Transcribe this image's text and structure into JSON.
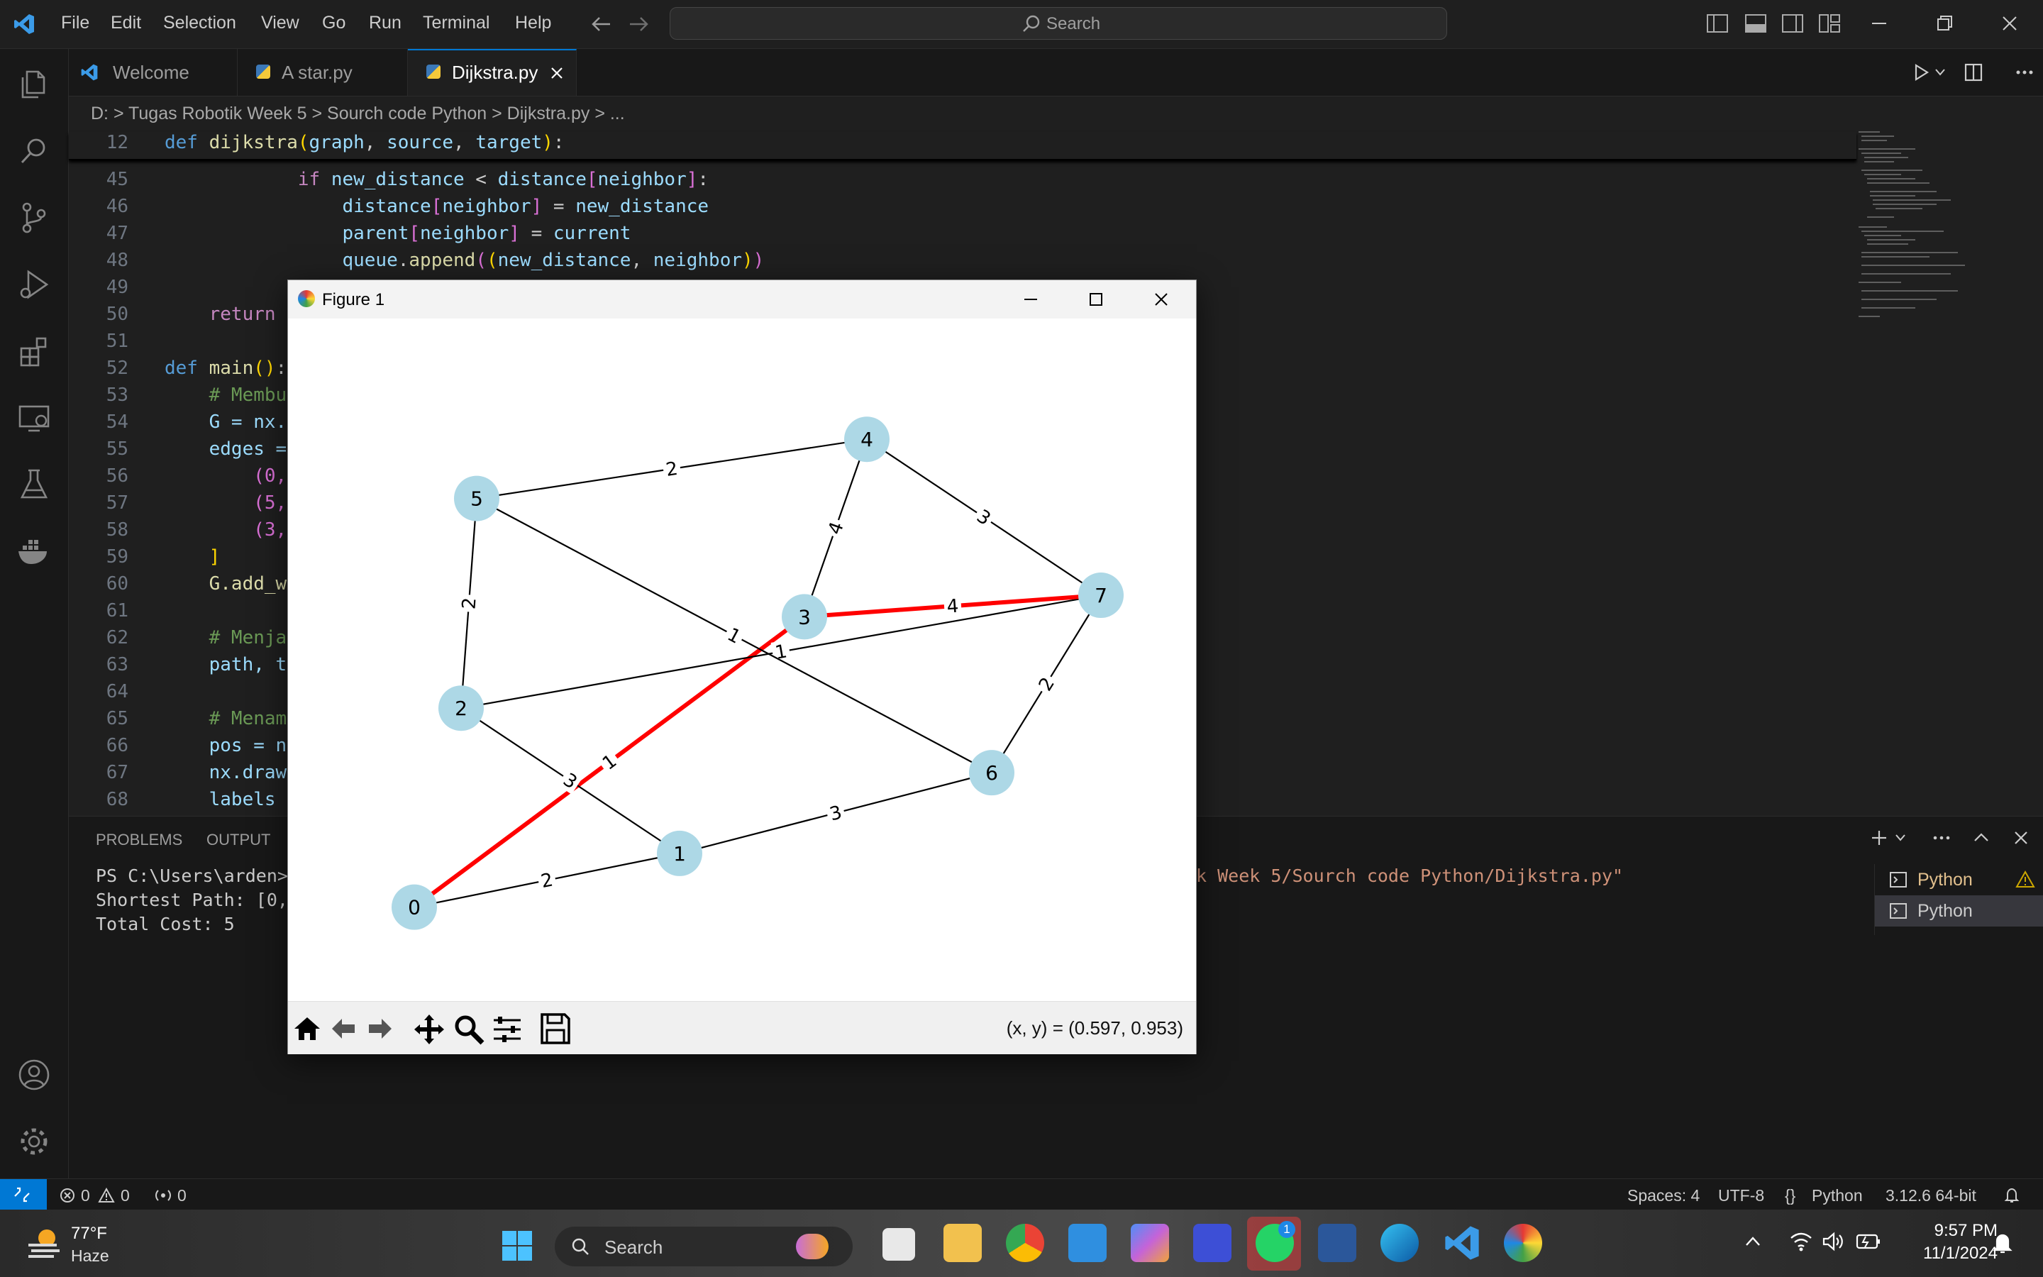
{
  "menu": [
    "File",
    "Edit",
    "Selection",
    "View",
    "Go",
    "Run",
    "Terminal",
    "Help"
  ],
  "search": {
    "placeholder": "Search"
  },
  "tabs": [
    {
      "label": "Welcome",
      "icon": "vscode-icon"
    },
    {
      "label": "A star.py",
      "icon": "python-icon"
    },
    {
      "label": "Dijkstra.py",
      "icon": "python-icon",
      "active": true
    }
  ],
  "breadcrumb": "D: > Tugas Robotik Week 5 > Sourch code Python > Dijkstra.py > ...",
  "sticky": {
    "ln": "12",
    "code": "def dijkstra(graph, source, target):"
  },
  "lines": [
    {
      "ln": "45",
      "code": "            if new_distance < distance[neighbor]:"
    },
    {
      "ln": "46",
      "code": "                distance[neighbor] = new_distance"
    },
    {
      "ln": "47",
      "code": "                parent[neighbor] = current"
    },
    {
      "ln": "48",
      "code": "                queue.append((new_distance, neighbor))"
    },
    {
      "ln": "49",
      "code": ""
    },
    {
      "ln": "50",
      "code": "    return"
    },
    {
      "ln": "51",
      "code": ""
    },
    {
      "ln": "52",
      "code": "def main():"
    },
    {
      "ln": "53",
      "code": "    # Membu"
    },
    {
      "ln": "54",
      "code": "    G = nx."
    },
    {
      "ln": "55",
      "code": "    edges ="
    },
    {
      "ln": "56",
      "code": "        (0,"
    },
    {
      "ln": "57",
      "code": "        (5,"
    },
    {
      "ln": "58",
      "code": "        (3,"
    },
    {
      "ln": "59",
      "code": "    ]"
    },
    {
      "ln": "60",
      "code": "    G.add_w"
    },
    {
      "ln": "61",
      "code": ""
    },
    {
      "ln": "62",
      "code": "    # Menja"
    },
    {
      "ln": "63",
      "code": "    path, t"
    },
    {
      "ln": "64",
      "code": ""
    },
    {
      "ln": "65",
      "code": "    # Menam"
    },
    {
      "ln": "66",
      "code": "    pos = n"
    },
    {
      "ln": "67",
      "code": "    nx.draw"
    },
    {
      "ln": "68",
      "code": "    labels"
    }
  ],
  "panel": {
    "tabs": [
      "PROBLEMS",
      "OUTPUT"
    ],
    "terminal": [
      "PS C:\\Users\\arden>",
      "Shortest Path: [0,",
      "Total Cost: 5"
    ],
    "terminal_tail": "k Week 5/Sourch code Python/Dijkstra.py\"",
    "terminals": [
      "Python",
      "Python"
    ]
  },
  "status": {
    "errors": "0",
    "warnings": "0",
    "ports": "0",
    "spaces": "Spaces: 4",
    "encoding": "UTF-8",
    "language": "Python",
    "interpreter": "3.12.6 64-bit"
  },
  "taskbar": {
    "weather_temp": "77°F",
    "weather_desc": "Haze",
    "search": "Search",
    "time": "9:57 PM",
    "date": "11/1/2024",
    "whatsapp_badge": "1"
  },
  "figure": {
    "title": "Figure 1",
    "coords": "(x, y) = (0.597, 0.953)"
  },
  "chart_data": {
    "type": "graph",
    "nodes": [
      {
        "id": "0",
        "x": 0.08,
        "y": 0.04
      },
      {
        "id": "1",
        "x": 0.42,
        "y": 0.14
      },
      {
        "id": "2",
        "x": 0.14,
        "y": 0.41
      },
      {
        "id": "3",
        "x": 0.58,
        "y": 0.58
      },
      {
        "id": "4",
        "x": 0.66,
        "y": 0.91
      },
      {
        "id": "5",
        "x": 0.16,
        "y": 0.8
      },
      {
        "id": "6",
        "x": 0.82,
        "y": 0.29
      },
      {
        "id": "7",
        "x": 0.96,
        "y": 0.62
      }
    ],
    "edges": [
      {
        "source": "0",
        "target": "1",
        "weight": "2",
        "path": false
      },
      {
        "source": "0",
        "target": "3",
        "weight": "1",
        "path": true
      },
      {
        "source": "1",
        "target": "2",
        "weight": "3",
        "path": false
      },
      {
        "source": "1",
        "target": "6",
        "weight": "3",
        "path": false
      },
      {
        "source": "2",
        "target": "5",
        "weight": "2",
        "path": false
      },
      {
        "source": "2",
        "target": "7",
        "weight": "1",
        "path": false
      },
      {
        "source": "5",
        "target": "4",
        "weight": "2",
        "path": false
      },
      {
        "source": "5",
        "target": "6",
        "weight": "1",
        "path": false
      },
      {
        "source": "3",
        "target": "4",
        "weight": "4",
        "path": false
      },
      {
        "source": "3",
        "target": "7",
        "weight": "4",
        "path": true
      },
      {
        "source": "4",
        "target": "7",
        "weight": "3",
        "path": false
      },
      {
        "source": "6",
        "target": "7",
        "weight": "2",
        "path": false
      }
    ],
    "colors": {
      "node": "#add8e6",
      "edge": "#000000",
      "path": "#ff0000"
    }
  }
}
